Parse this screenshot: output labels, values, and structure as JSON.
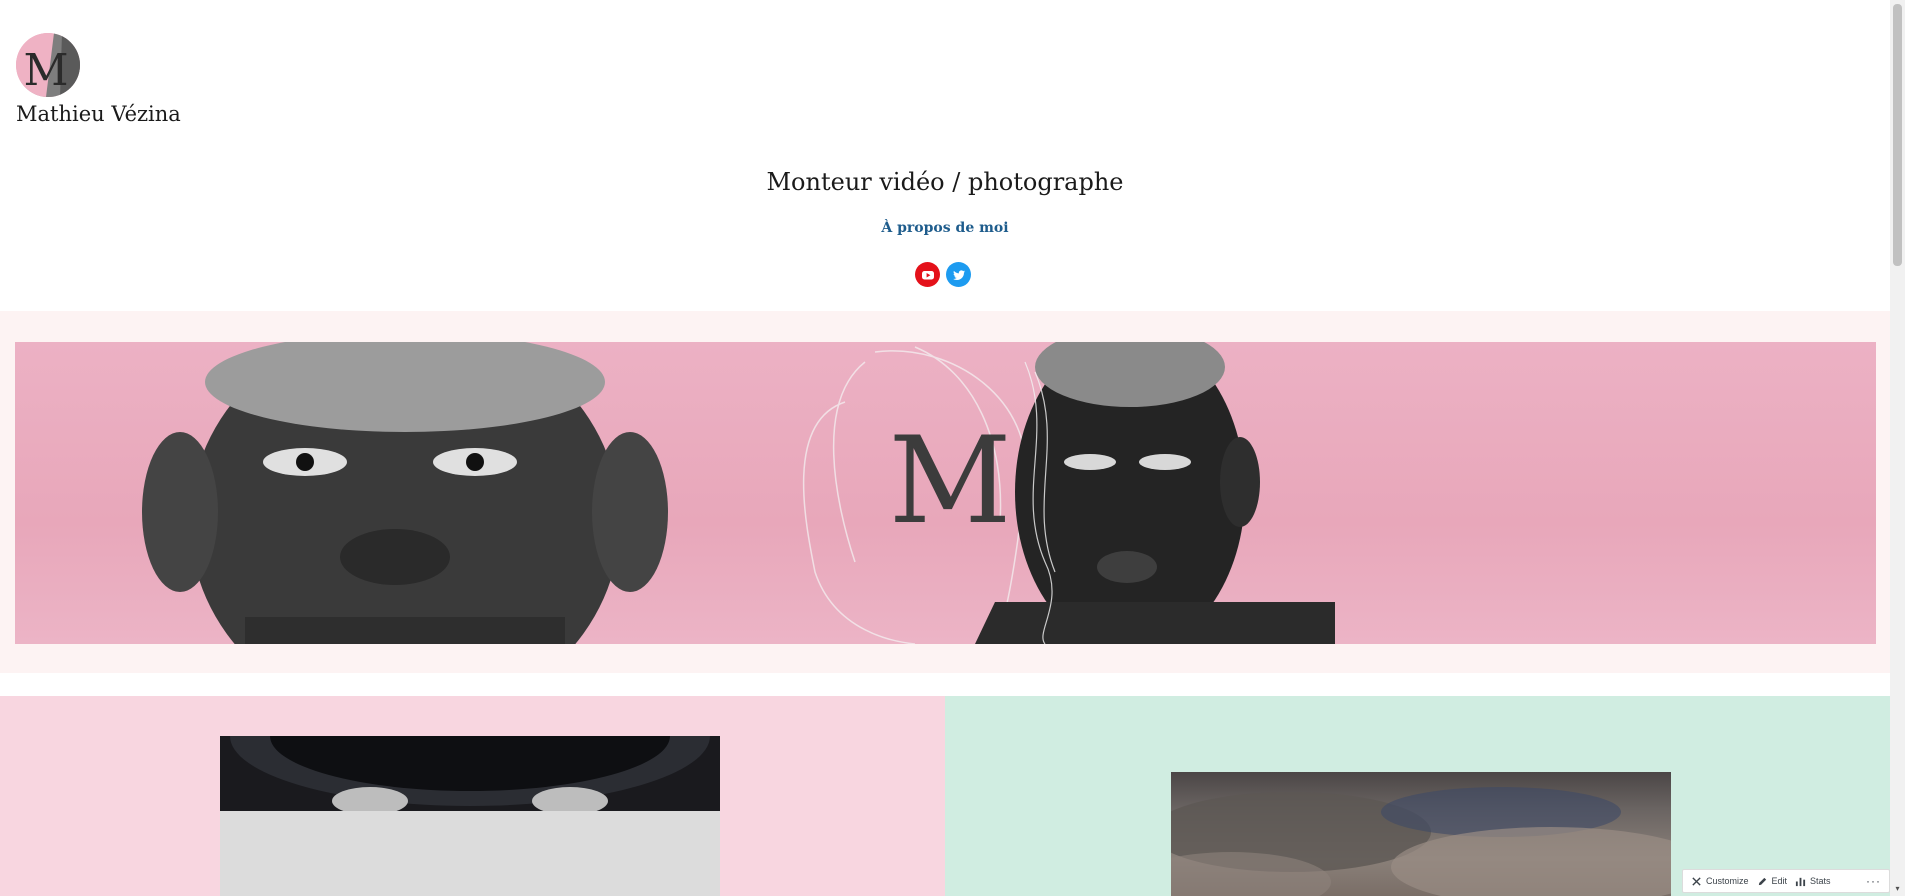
{
  "site": {
    "title": "Mathieu Vézina",
    "tagline": "Monteur vidéo / photographe",
    "about_link": "À propos de moi",
    "logo_letter": "M"
  },
  "social": [
    {
      "name": "youtube-icon",
      "color": "#e4111a"
    },
    {
      "name": "twitter-icon",
      "color": "#1d9bf0"
    }
  ],
  "banner": {
    "letter": "M",
    "background": "#e9aabd"
  },
  "sections": {
    "left_background": "#f8d6e0",
    "right_background": "#d0ede1"
  },
  "admin_bar": {
    "customize": "Customize",
    "edit": "Edit",
    "stats": "Stats",
    "more": "···"
  }
}
